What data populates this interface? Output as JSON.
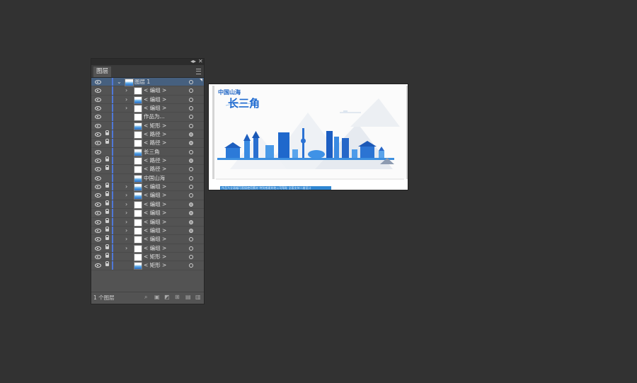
{
  "panel": {
    "tab_label": "图层",
    "footer_count": "1 个图层",
    "top_layer": {
      "name": "图层 1"
    },
    "rows": [
      {
        "name": "< 编组 >",
        "locked": false,
        "chevron": true,
        "thumb": "blank",
        "target": "hollow"
      },
      {
        "name": "< 编组 >",
        "locked": false,
        "chevron": true,
        "thumb": "img",
        "target": "hollow"
      },
      {
        "name": "< 编组 >",
        "locked": false,
        "chevron": true,
        "thumb": "blank",
        "target": "hollow"
      },
      {
        "name": "作品为...",
        "locked": false,
        "chevron": false,
        "thumb": "blank",
        "target": "hollow"
      },
      {
        "name": "< 矩形 >",
        "locked": false,
        "chevron": false,
        "thumb": "img",
        "target": "hollow"
      },
      {
        "name": "< 路径 >",
        "locked": true,
        "chevron": false,
        "thumb": "blank",
        "target": "filled"
      },
      {
        "name": "< 路径 >",
        "locked": true,
        "chevron": false,
        "thumb": "blank",
        "target": "filled"
      },
      {
        "name": "长三角",
        "locked": false,
        "chevron": false,
        "thumb": "img",
        "target": "hollow"
      },
      {
        "name": "< 路径 >",
        "locked": true,
        "chevron": false,
        "thumb": "blank",
        "target": "filled"
      },
      {
        "name": "< 路径 >",
        "locked": true,
        "chevron": false,
        "thumb": "blank",
        "target": "hollow"
      },
      {
        "name": "中国山海",
        "locked": false,
        "chevron": false,
        "thumb": "img",
        "target": "hollow"
      },
      {
        "name": "< 编组 >",
        "locked": true,
        "chevron": true,
        "thumb": "img",
        "target": "hollow"
      },
      {
        "name": "< 编组 >",
        "locked": true,
        "chevron": true,
        "thumb": "img",
        "target": "hollow"
      },
      {
        "name": "< 编组 >",
        "locked": true,
        "chevron": true,
        "thumb": "blank",
        "target": "filled"
      },
      {
        "name": "< 编组 >",
        "locked": true,
        "chevron": true,
        "thumb": "blank",
        "target": "filled"
      },
      {
        "name": "< 编组 >",
        "locked": true,
        "chevron": true,
        "thumb": "blank",
        "target": "filled"
      },
      {
        "name": "< 编组 >",
        "locked": true,
        "chevron": true,
        "thumb": "blank",
        "target": "filled"
      },
      {
        "name": "< 编组 >",
        "locked": true,
        "chevron": true,
        "thumb": "blank",
        "target": "hollow"
      },
      {
        "name": "< 编组 >",
        "locked": true,
        "chevron": true,
        "thumb": "blank",
        "target": "hollow"
      },
      {
        "name": "< 矩形 >",
        "locked": true,
        "chevron": false,
        "thumb": "blank",
        "target": "hollow"
      },
      {
        "name": "< 矩形 >",
        "locked": true,
        "chevron": false,
        "thumb": "img",
        "target": "hollow"
      }
    ],
    "footer_icons": [
      "search-icon",
      "locate-object-icon",
      "make-clipping-mask-icon",
      "new-sublayer-icon",
      "new-layer-icon",
      "trash-icon"
    ]
  },
  "artboard": {
    "sub_title": "中国山海",
    "main_title": "长三角",
    "caption": "作品为全画幅可直接使用素材 特别感谢其他公司帮助 全面支持二维设计"
  },
  "colors": {
    "layer_color": "#4f78d8",
    "accent_blue": "#1e6ad0",
    "selection_row": "#46607f"
  }
}
